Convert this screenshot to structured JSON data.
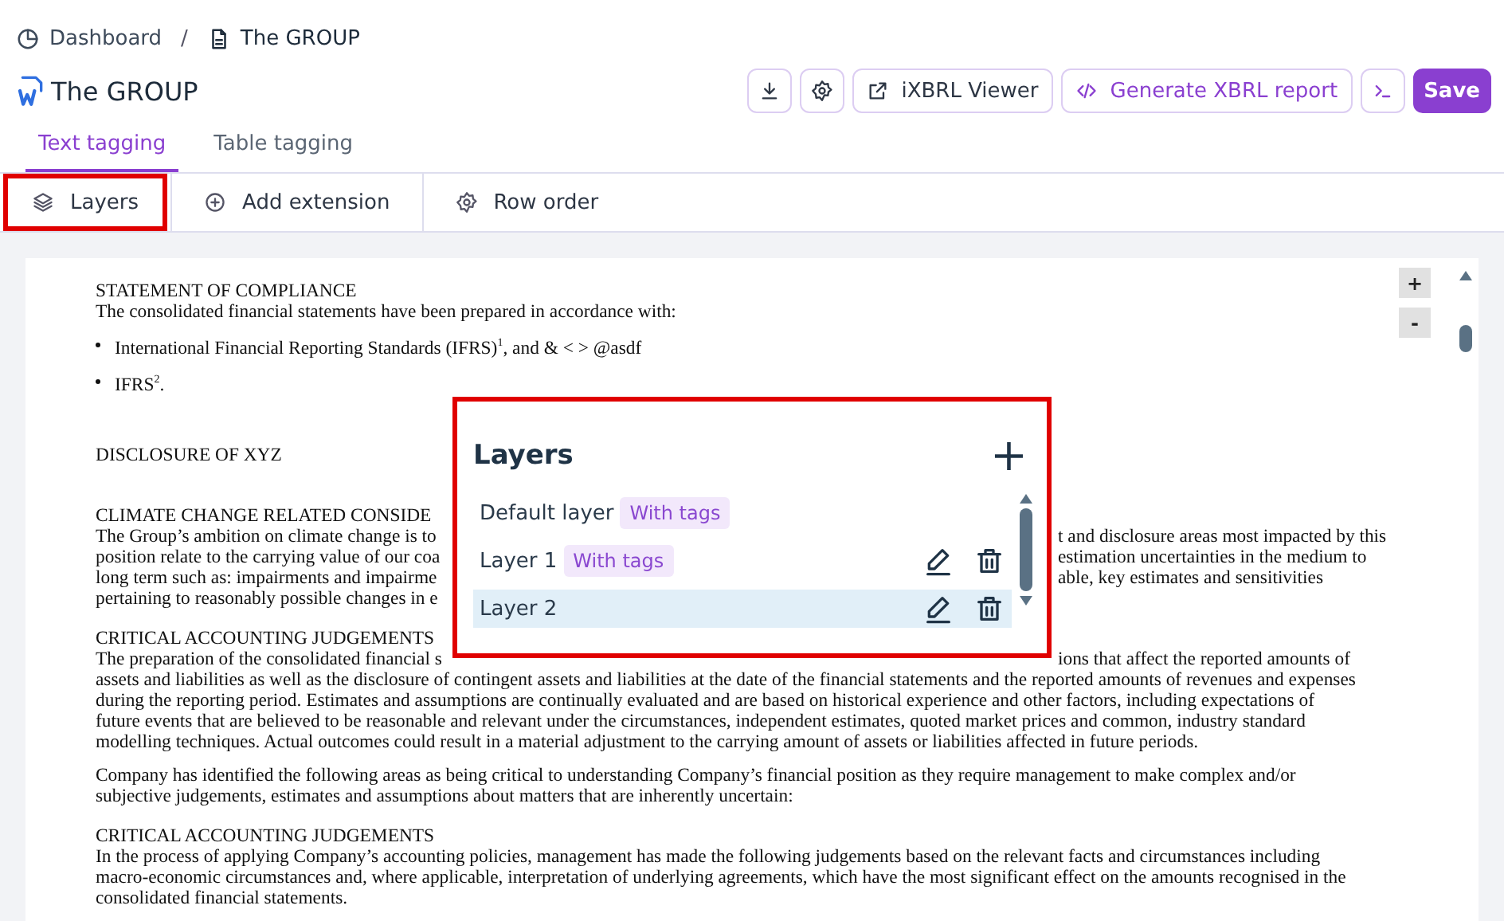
{
  "breadcrumb_separator": "/",
  "breadcrumbs": [
    {
      "label": "Dashboard",
      "kind": "dashboard"
    },
    {
      "label": "The GROUP",
      "kind": "document"
    }
  ],
  "title": "The GROUP",
  "actions": [
    {
      "kind": "download"
    },
    {
      "kind": "settings"
    },
    {
      "kind": "viewer",
      "label": "iXBRL Viewer"
    },
    {
      "kind": "generate",
      "label": "Generate XBRL report"
    },
    {
      "kind": "terminal"
    },
    {
      "kind": "save",
      "label": "Save"
    }
  ],
  "tabs": [
    {
      "label": "Text tagging",
      "selected": true
    },
    {
      "label": "Table tagging",
      "selected": false
    }
  ],
  "toolbar": [
    {
      "kind": "layers",
      "label": "Layers",
      "highlighted": true
    },
    {
      "kind": "add",
      "label": "Add extension",
      "highlighted": false
    },
    {
      "kind": "order",
      "label": "Row order",
      "highlighted": false
    }
  ],
  "document": {
    "zoom_in": "+",
    "zoom_out": "-",
    "blocks": [
      {
        "kind": "heading",
        "text": "STATEMENT OF COMPLIANCE"
      },
      {
        "kind": "paragraph",
        "lines": [
          {
            "left": "The consolidated financial statements have been prepared in accordance with:"
          }
        ]
      },
      {
        "kind": "bullet",
        "text": "International Financial Reporting Standards (IFRS)$^{1}$, and & < > @asdf"
      },
      {
        "kind": "bullet",
        "text": "IFRS$^{2}$."
      },
      {
        "kind": "heading",
        "text": "DISCLOSURE OF XYZ"
      },
      {
        "kind": "heading",
        "text": "CLIMATE CHANGE RELATED CONSIDE"
      },
      {
        "kind": "paragraph",
        "lines": [
          {
            "left": "The Group’s ambition on climate change is to",
            "right": "t and disclosure areas most impacted by this"
          },
          {
            "left": "position relate to the carrying value of our coa",
            "right": "estimation uncertainties in the medium to"
          },
          {
            "left": "long term such as: impairments and impairme",
            "right": "able, key estimates and sensitivities"
          },
          {
            "left": "pertaining to reasonably possible changes in e"
          }
        ]
      },
      {
        "kind": "heading",
        "text": "CRITICAL ACCOUNTING JUDGEMENTS"
      },
      {
        "kind": "paragraph",
        "lines": [
          {
            "left": "The preparation of the consolidated financial s",
            "right": "ions that affect the reported amounts of"
          },
          {
            "left": "assets and liabilities as well as the disclosure of contingent assets and liabilities at the date of the financial statements and the reported amounts of revenues and expenses"
          },
          {
            "left": "during the reporting period. Estimates and assumptions are continually evaluated and are based on historical experience and other factors, including expectations of"
          },
          {
            "left": "future events that are believed to be reasonable and relevant under the circumstances, independent estimates, quoted market prices and common, industry standard"
          },
          {
            "left": "modelling techniques. Actual outcomes could result in a material adjustment to the carrying amount of assets or liabilities affected in future periods."
          }
        ]
      },
      {
        "kind": "paragraph",
        "lines": [
          {
            "left": "Company has identified the following areas as being critical to understanding Company’s financial position as they require management to make complex and/or"
          },
          {
            "left": "subjective judgements, estimates and assumptions about matters that are inherently uncertain:"
          }
        ]
      },
      {
        "kind": "heading",
        "text": "CRITICAL ACCOUNTING JUDGEMENTS"
      },
      {
        "kind": "paragraph",
        "lines": [
          {
            "left": "In the process of applying Company’s accounting policies, management has made the following judgements based on the relevant facts and circumstances including"
          },
          {
            "left": "macro-economic circumstances and, where applicable, interpretation of underlying agreements, which have the most significant effect on the amounts recognised in the"
          },
          {
            "left": "consolidated financial statements."
          }
        ]
      }
    ]
  },
  "layers_panel": {
    "title": "Layers",
    "add": "+",
    "layers": [
      {
        "name": "Default layer",
        "tag": "With tags",
        "kind": "default",
        "selected": false
      },
      {
        "name": "Layer 1",
        "tag": "With tags",
        "kind": "custom",
        "selected": false
      },
      {
        "name": "Layer 2",
        "kind": "custom",
        "selected": true
      }
    ]
  }
}
